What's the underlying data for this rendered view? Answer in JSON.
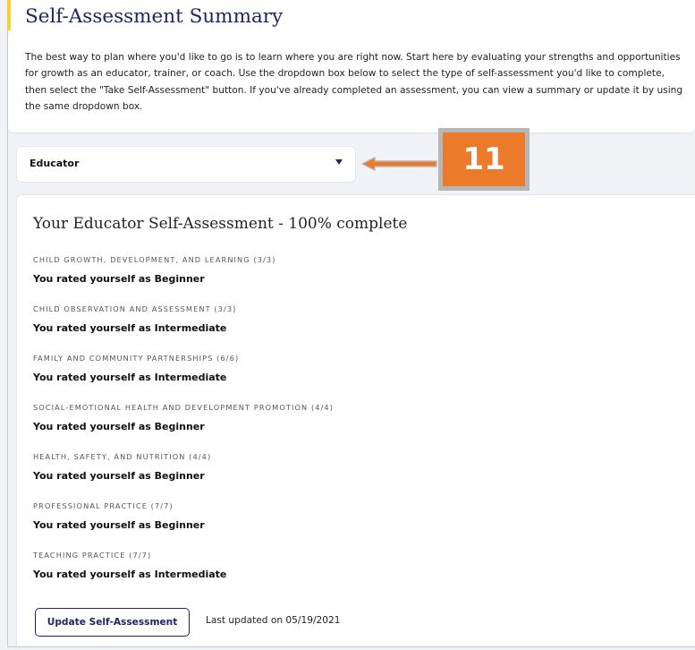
{
  "header": {
    "title": "Self-Assessment Summary",
    "intro": "The best way to plan where you'd like to go is to learn where you are right now. Start here by evaluating your strengths and opportunities for growth as an educator, trainer, or coach. Use the dropdown box below to select the type of self-assessment you'd like to complete, then select the \"Take Self-Assessment\" button. If you've already completed an assessment, you can view a summary or update it by using the same dropdown box."
  },
  "dropdown": {
    "selected": "Educator"
  },
  "callout": {
    "number": "11"
  },
  "summary": {
    "title": "Your Educator Self-Assessment - 100% complete",
    "competencies": [
      {
        "label": "CHILD GROWTH, DEVELOPMENT, AND LEARNING (3/3)",
        "rating": "You rated yourself as Beginner"
      },
      {
        "label": "CHILD OBSERVATION AND ASSESSMENT (3/3)",
        "rating": "You rated yourself as Intermediate"
      },
      {
        "label": "FAMILY AND COMMUNITY PARTNERSHIPS (6/6)",
        "rating": "You rated yourself as Intermediate"
      },
      {
        "label": "SOCIAL-EMOTIONAL HEALTH AND DEVELOPMENT PROMOTION (4/4)",
        "rating": "You rated yourself as Beginner"
      },
      {
        "label": "HEALTH, SAFETY, AND NUTRITION (4/4)",
        "rating": "You rated yourself as Beginner"
      },
      {
        "label": "PROFESSIONAL PRACTICE (7/7)",
        "rating": "You rated yourself as Beginner"
      },
      {
        "label": "TEACHING PRACTICE (7/7)",
        "rating": "You rated yourself as Intermediate"
      }
    ],
    "update_button": "Update Self-Assessment",
    "last_updated": "Last updated on 05/19/2021"
  },
  "colors": {
    "title": "#1f2367",
    "accent": "#f6d13a",
    "callout": "#ec7a2b",
    "callout_border": "#b7b7b7"
  },
  "icons": {
    "dropdown": "caret-down-icon",
    "pointer": "arrow-left-icon"
  }
}
